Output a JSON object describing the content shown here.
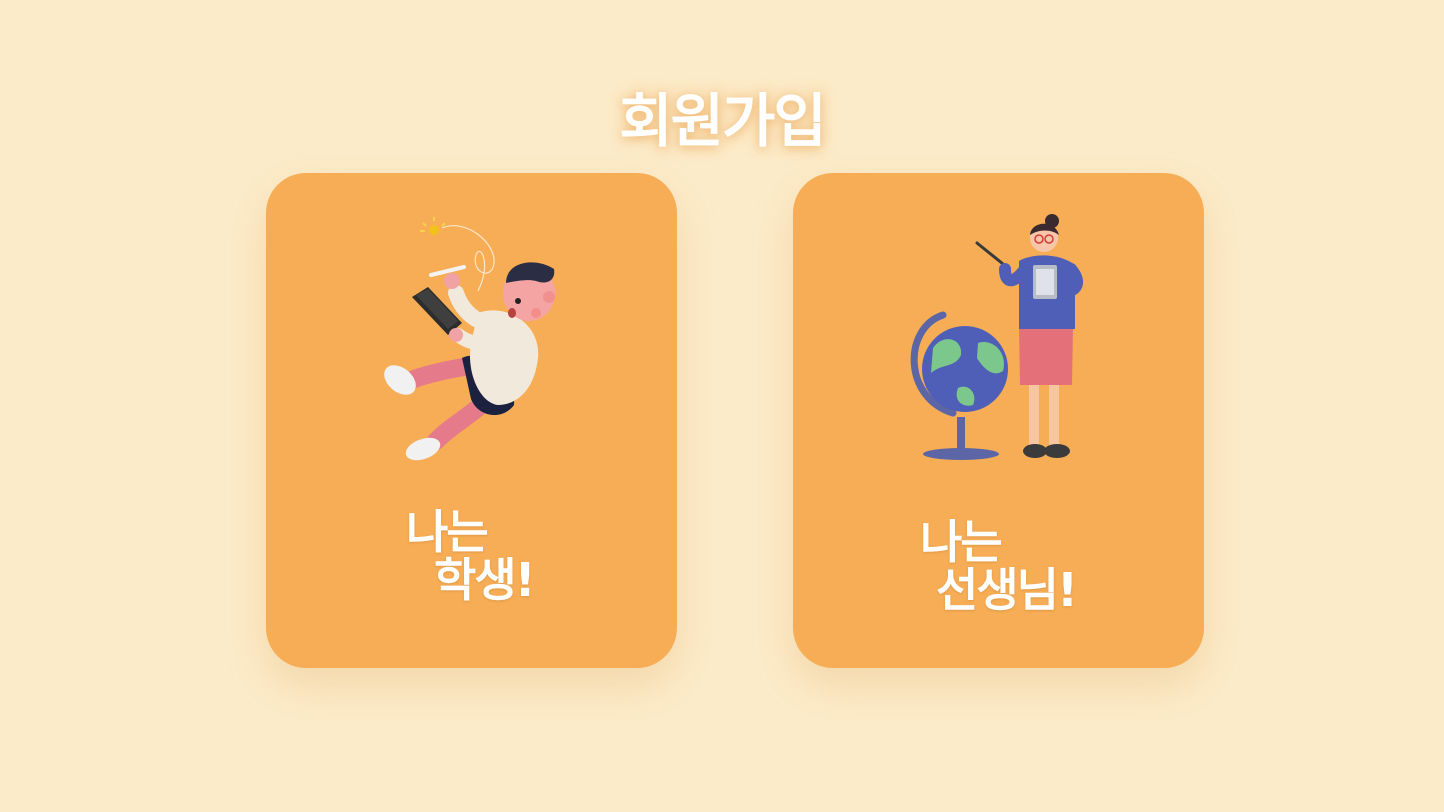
{
  "page": {
    "title": "회원가입"
  },
  "cards": [
    {
      "id": "student",
      "label_line1": "나는",
      "label_line2": "학생!",
      "illustration": "student-illustration"
    },
    {
      "id": "teacher",
      "label_line1": "나는",
      "label_line2": "선생님!",
      "illustration": "teacher-illustration"
    }
  ],
  "colors": {
    "background": "#fcebc9",
    "card": "#f6ad55",
    "text": "#ffffff"
  }
}
